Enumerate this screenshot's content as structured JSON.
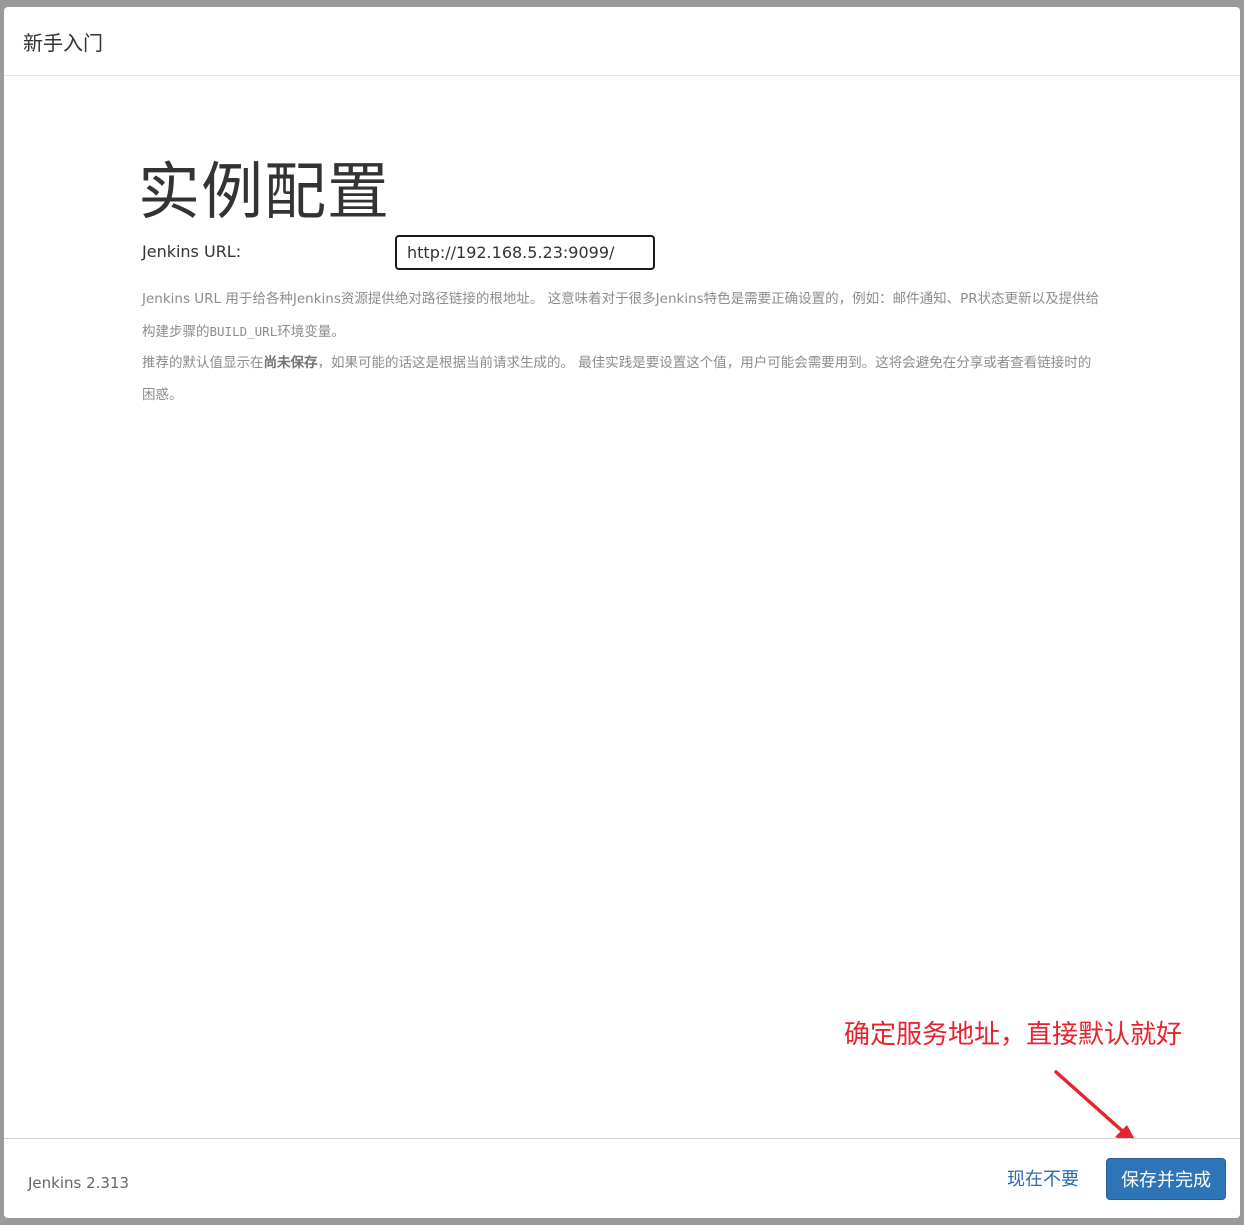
{
  "header": {
    "title": "新手入门"
  },
  "main": {
    "page_title": "实例配置",
    "url_label": "Jenkins URL:",
    "url_value": "http://192.168.5.23:9099/",
    "help_line1_part1": "Jenkins URL 用于给各种Jenkins资源提供绝对路径链接的根地址。 这意味着对于很多Jenkins特色是需要正确设置的，例如：邮件通知、PR状态更新以及提供给构建步骤的",
    "help_line1_code": "BUILD_URL",
    "help_line1_part2": "环境变量。",
    "help_line2_part1": "推荐的默认值显示在",
    "help_line2_bold": "尚未保存",
    "help_line2_part2": "，如果可能的话这是根据当前请求生成的。 最佳实践是要设置这个值，用户可能会需要用到。这将会避免在分享或者查看链接时的困惑。"
  },
  "annotation": {
    "text": "确定服务地址，直接默认就好",
    "color": "#e8222e"
  },
  "footer": {
    "version": "Jenkins 2.313",
    "skip_label": "现在不要",
    "save_label": "保存并完成"
  },
  "colors": {
    "accent": "#2e75b8",
    "link": "#2a6ab4"
  }
}
